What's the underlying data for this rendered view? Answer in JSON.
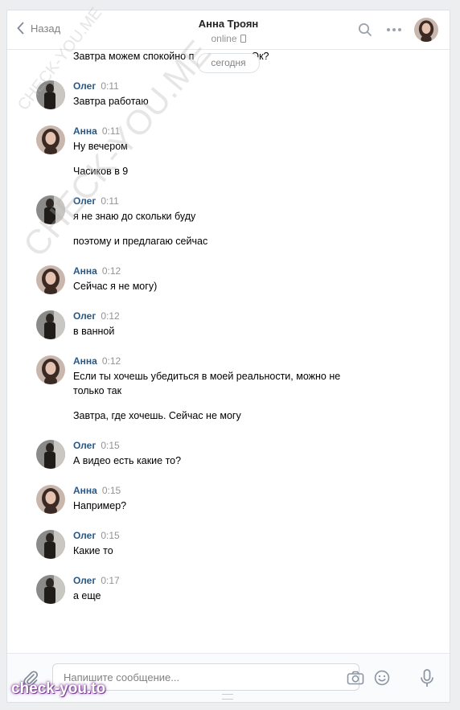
{
  "header": {
    "back_label": "Назад",
    "title": "Анна Троян",
    "status": "online"
  },
  "chat": {
    "top_text_part1": "Завтра можем спокойно п",
    "top_text_part2": "Ок?",
    "date_divider": "сегодня",
    "messages": [
      {
        "author": "Олег",
        "time": "0:11",
        "lines": [
          "Завтра работаю"
        ],
        "avatar": "oleg"
      },
      {
        "author": "Анна",
        "time": "0:11",
        "lines": [
          "Ну вечером",
          "Часиков в 9"
        ],
        "avatar": "anna"
      },
      {
        "author": "Олег",
        "time": "0:11",
        "lines": [
          "я не знаю до скольки буду",
          "поэтому и предлагаю сейчас"
        ],
        "avatar": "oleg"
      },
      {
        "author": "Анна",
        "time": "0:12",
        "lines": [
          "Сейчас я не могу)"
        ],
        "avatar": "anna"
      },
      {
        "author": "Олег",
        "time": "0:12",
        "lines": [
          "в ванной"
        ],
        "avatar": "oleg"
      },
      {
        "author": "Анна",
        "time": "0:12",
        "lines": [
          "Если ты хочешь убедиться в моей реальности, можно не только так",
          "Завтра, где хочешь. Сейчас не могу"
        ],
        "avatar": "anna"
      },
      {
        "author": "Олег",
        "time": "0:15",
        "lines": [
          "А видео есть какие то?"
        ],
        "avatar": "oleg"
      },
      {
        "author": "Анна",
        "time": "0:15",
        "lines": [
          "Например?"
        ],
        "avatar": "anna"
      },
      {
        "author": "Олег",
        "time": "0:15",
        "lines": [
          "Какие то"
        ],
        "avatar": "oleg"
      },
      {
        "author": "Олег",
        "time": "0:17",
        "lines": [
          "а еще"
        ],
        "avatar": "oleg"
      }
    ]
  },
  "composer": {
    "placeholder": "Напишите сообщение..."
  },
  "watermarks": {
    "diag_small": "CHECK-YOU.ME",
    "diag_large": "CHECK-YOU.ME",
    "bottom": "check-you.to"
  },
  "colors": {
    "link": "#2a5885",
    "muted": "#939393",
    "watermark_glow": "#7d3b95"
  },
  "icons": [
    "chevron-left-icon",
    "search-icon",
    "more-icon",
    "phone-icon",
    "paperclip-icon",
    "camera-icon",
    "smile-icon",
    "microphone-icon"
  ]
}
